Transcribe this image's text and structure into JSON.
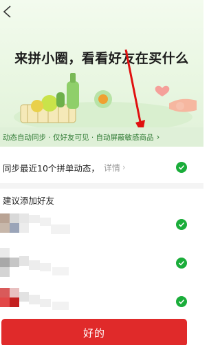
{
  "banner": {
    "headline": "来拼小圈，看看好友在买什么"
  },
  "features": {
    "text": "动态自动同步 · 仅好友可见 · 自动屏蔽敏感商品",
    "chevron": "›"
  },
  "sync": {
    "label": "同步最近10个拼单动态，",
    "detail": "详情",
    "detail_chevron": "›",
    "checked": true
  },
  "suggest": {
    "title": "建议添加好友",
    "friends": [
      {
        "checked": true
      },
      {
        "checked": true
      },
      {
        "checked": true
      }
    ]
  },
  "confirm": {
    "label": "好的"
  },
  "colors": {
    "accent_red": "#e02a2a",
    "check_green": "#1aad3a",
    "feature_green": "#2f7a33"
  }
}
